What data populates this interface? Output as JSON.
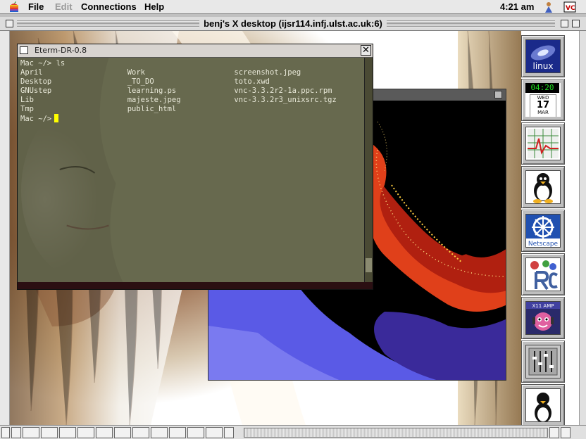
{
  "menubar": {
    "file": "File",
    "edit": "Edit",
    "connections": "Connections",
    "help": "Help",
    "clock": "4:21 am"
  },
  "window": {
    "title": "benj's X desktop (ijsr114.infj.ulst.ac.uk:6)"
  },
  "eterm": {
    "title": "Eterm-DR-0.8",
    "lines": [
      "Mac ~/> ls",
      "April                   Work                    screenshot.jpeg",
      "Desktop                 _TO_DO                  toto.xwd",
      "GNUstep                 learning.ps             vnc-3.3.2r2-1a.ppc.rpm",
      "Lib                     majeste.jpeg            vnc-3.3.2r3_unixsrc.tgz",
      "Tmp                     public_html",
      "Mac ~/>"
    ]
  },
  "dock": {
    "linux_label": "linux",
    "clock_time": "04:20",
    "cal_day": "WED",
    "cal_date": "17",
    "cal_month": "MAR",
    "netscape_label": "Netscape",
    "xmms_label": "X11 AMP"
  },
  "icons": [
    "apple-icon",
    "finder-icon",
    "close-icon",
    "linux-icon",
    "clock-icon",
    "calendar-icon",
    "monitor-icon",
    "tux-icon",
    "netscape-icon",
    "irc-icon",
    "xmms-icon",
    "mixer-icon"
  ]
}
